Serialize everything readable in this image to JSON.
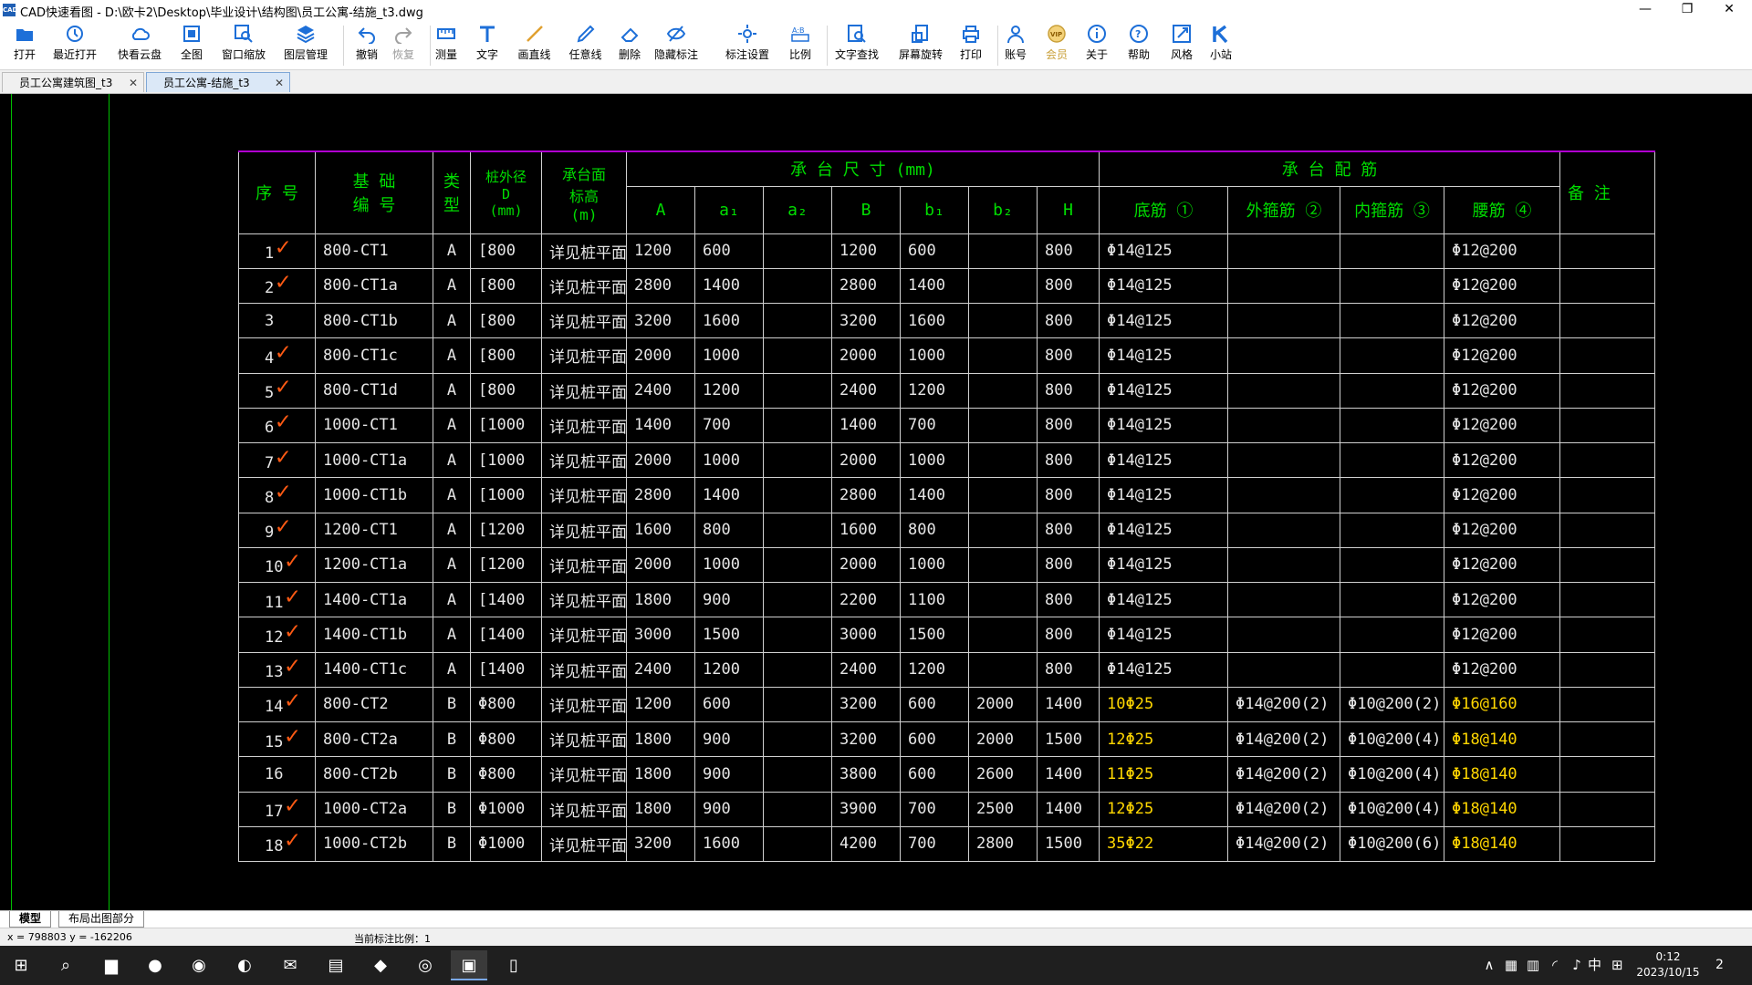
{
  "window": {
    "title": "CAD快速看图 - D:\\欧卡2\\Desktop\\毕业设计\\结构图\\员工公寓-结施_t3.dwg",
    "minimize_glyph": "—",
    "restore_glyph": "❐",
    "close_glyph": "✕"
  },
  "toolbar": [
    {
      "label": "打开",
      "icon": "folder-open-icon"
    },
    {
      "label": "最近打开",
      "icon": "history-icon"
    },
    {
      "label": "快看云盘",
      "icon": "cloud-icon"
    },
    {
      "label": "全图",
      "icon": "fit-all-icon"
    },
    {
      "label": "窗口缩放",
      "icon": "zoom-window-icon"
    },
    {
      "label": "图层管理",
      "icon": "layers-icon"
    },
    {
      "label": "撤销",
      "icon": "undo-icon"
    },
    {
      "label": "恢复",
      "icon": "redo-icon",
      "disabled": true
    },
    {
      "label": "测量",
      "icon": "measure-icon"
    },
    {
      "label": "文字",
      "icon": "text-icon"
    },
    {
      "label": "画直线",
      "icon": "line-icon"
    },
    {
      "label": "任意线",
      "icon": "freehand-icon"
    },
    {
      "label": "删除",
      "icon": "eraser-icon"
    },
    {
      "label": "隐藏标注",
      "icon": "hide-annotation-icon"
    },
    {
      "label": "标注设置",
      "icon": "annotation-settings-icon"
    },
    {
      "label": "比例",
      "icon": "scale-icon"
    },
    {
      "label": "文字查找",
      "icon": "text-search-icon"
    },
    {
      "label": "屏幕旋转",
      "icon": "rotate-screen-icon"
    },
    {
      "label": "打印",
      "icon": "printer-icon"
    },
    {
      "label": "账号",
      "icon": "user-icon"
    },
    {
      "label": "会员",
      "icon": "vip-icon",
      "vip": true
    },
    {
      "label": "关于",
      "icon": "info-icon"
    },
    {
      "label": "帮助",
      "icon": "help-icon"
    },
    {
      "label": "风格",
      "icon": "style-icon"
    },
    {
      "label": "小站",
      "icon": "k-site-icon"
    }
  ],
  "tabs": [
    {
      "label": "员工公寓建筑图_t3",
      "close": "✕",
      "active": false
    },
    {
      "label": "员工公寓-结施_t3",
      "close": "✕",
      "active": true
    }
  ],
  "table": {
    "head": {
      "no": "序 号",
      "name": "基  础\n编  号",
      "type": "类\n型",
      "pile": "桩外径\nD\n(mm)",
      "elev": "承台面\n标高\n(m)",
      "size_group": "承  台  尺  寸      (mm)",
      "rebar_group": "承      台      配      筋",
      "remark": "备  注",
      "size_cols": [
        "A",
        "a₁",
        "a₂",
        "B",
        "b₁",
        "b₂",
        "H"
      ],
      "rebar_cols": [
        "底筋 ①",
        "外箍筋 ②",
        "内箍筋 ③",
        "腰筋 ④"
      ]
    },
    "check_glyph": "✓",
    "rows": [
      {
        "no": "1",
        "check": true,
        "name": "800-CT1",
        "type": "A",
        "pile": "[800",
        "elev": "详见桩平面",
        "A": "1200",
        "a1": "600",
        "a2": "",
        "B": "1200",
        "b1": "600",
        "b2": "",
        "H": "800",
        "r1": "Φ14@125",
        "r2": "",
        "r3": "",
        "r4": "Φ12@200"
      },
      {
        "no": "2",
        "check": true,
        "name": "800-CT1a",
        "type": "A",
        "pile": "[800",
        "elev": "详见桩平面",
        "A": "2800",
        "a1": "1400",
        "a2": "",
        "B": "2800",
        "b1": "1400",
        "b2": "",
        "H": "800",
        "r1": "Φ14@125",
        "r2": "",
        "r3": "",
        "r4": "Φ12@200"
      },
      {
        "no": "3",
        "check": false,
        "name": "800-CT1b",
        "type": "A",
        "pile": "[800",
        "elev": "详见桩平面",
        "A": "3200",
        "a1": "1600",
        "a2": "",
        "B": "3200",
        "b1": "1600",
        "b2": "",
        "H": "800",
        "r1": "Φ14@125",
        "r2": "",
        "r3": "",
        "r4": "Φ12@200"
      },
      {
        "no": "4",
        "check": true,
        "name": "800-CT1c",
        "type": "A",
        "pile": "[800",
        "elev": "详见桩平面",
        "A": "2000",
        "a1": "1000",
        "a2": "",
        "B": "2000",
        "b1": "1000",
        "b2": "",
        "H": "800",
        "r1": "Φ14@125",
        "r2": "",
        "r3": "",
        "r4": "Φ12@200"
      },
      {
        "no": "5",
        "check": true,
        "name": "800-CT1d",
        "type": "A",
        "pile": "[800",
        "elev": "详见桩平面",
        "A": "2400",
        "a1": "1200",
        "a2": "",
        "B": "2400",
        "b1": "1200",
        "b2": "",
        "H": "800",
        "r1": "Φ14@125",
        "r2": "",
        "r3": "",
        "r4": "Φ12@200"
      },
      {
        "no": "6",
        "check": true,
        "name": "1000-CT1",
        "type": "A",
        "pile": "[1000",
        "elev": "详见桩平面",
        "A": "1400",
        "a1": "700",
        "a2": "",
        "B": "1400",
        "b1": "700",
        "b2": "",
        "H": "800",
        "r1": "Φ14@125",
        "r2": "",
        "r3": "",
        "r4": "Φ12@200"
      },
      {
        "no": "7",
        "check": true,
        "name": "1000-CT1a",
        "type": "A",
        "pile": "[1000",
        "elev": "详见桩平面",
        "A": "2000",
        "a1": "1000",
        "a2": "",
        "B": "2000",
        "b1": "1000",
        "b2": "",
        "H": "800",
        "r1": "Φ14@125",
        "r2": "",
        "r3": "",
        "r4": "Φ12@200"
      },
      {
        "no": "8",
        "check": true,
        "name": "1000-CT1b",
        "type": "A",
        "pile": "[1000",
        "elev": "详见桩平面",
        "A": "2800",
        "a1": "1400",
        "a2": "",
        "B": "2800",
        "b1": "1400",
        "b2": "",
        "H": "800",
        "r1": "Φ14@125",
        "r2": "",
        "r3": "",
        "r4": "Φ12@200"
      },
      {
        "no": "9",
        "check": true,
        "name": "1200-CT1",
        "type": "A",
        "pile": "[1200",
        "elev": "详见桩平面",
        "A": "1600",
        "a1": "800",
        "a2": "",
        "B": "1600",
        "b1": "800",
        "b2": "",
        "H": "800",
        "r1": "Φ14@125",
        "r2": "",
        "r3": "",
        "r4": "Φ12@200"
      },
      {
        "no": "10",
        "check": true,
        "name": "1200-CT1a",
        "type": "A",
        "pile": "[1200",
        "elev": "详见桩平面",
        "A": "2000",
        "a1": "1000",
        "a2": "",
        "B": "2000",
        "b1": "1000",
        "b2": "",
        "H": "800",
        "r1": "Φ14@125",
        "r2": "",
        "r3": "",
        "r4": "Φ12@200"
      },
      {
        "no": "11",
        "check": true,
        "name": "1400-CT1a",
        "type": "A",
        "pile": "[1400",
        "elev": "详见桩平面",
        "A": "1800",
        "a1": "900",
        "a2": "",
        "B": "2200",
        "b1": "1100",
        "b2": "",
        "H": "800",
        "r1": "Φ14@125",
        "r2": "",
        "r3": "",
        "r4": "Φ12@200"
      },
      {
        "no": "12",
        "check": true,
        "name": "1400-CT1b",
        "type": "A",
        "pile": "[1400",
        "elev": "详见桩平面",
        "A": "3000",
        "a1": "1500",
        "a2": "",
        "B": "3000",
        "b1": "1500",
        "b2": "",
        "H": "800",
        "r1": "Φ14@125",
        "r2": "",
        "r3": "",
        "r4": "Φ12@200"
      },
      {
        "no": "13",
        "check": true,
        "name": "1400-CT1c",
        "type": "A",
        "pile": "[1400",
        "elev": "详见桩平面",
        "A": "2400",
        "a1": "1200",
        "a2": "",
        "B": "2400",
        "b1": "1200",
        "b2": "",
        "H": "800",
        "r1": "Φ14@125",
        "r2": "",
        "r3": "",
        "r4": "Φ12@200"
      },
      {
        "no": "14",
        "check": true,
        "name": "800-CT2",
        "type": "B",
        "pile": "Φ800",
        "elev": "详见桩平面",
        "A": "1200",
        "a1": "600",
        "a2": "",
        "B": "3200",
        "b1": "600",
        "b2": "2000",
        "H": "1400",
        "r1": "10Φ25",
        "r2": "Φ14@200(2)",
        "r3": "Φ10@200(2)",
        "r4": "Φ16@160"
      },
      {
        "no": "15",
        "check": true,
        "name": "800-CT2a",
        "type": "B",
        "pile": "Φ800",
        "elev": "详见桩平面",
        "A": "1800",
        "a1": "900",
        "a2": "",
        "B": "3200",
        "b1": "600",
        "b2": "2000",
        "H": "1500",
        "r1": "12Φ25",
        "r2": "Φ14@200(2)",
        "r3": "Φ10@200(4)",
        "r4": "Φ18@140"
      },
      {
        "no": "16",
        "check": false,
        "name": "800-CT2b",
        "type": "B",
        "pile": "Φ800",
        "elev": "详见桩平面",
        "A": "1800",
        "a1": "900",
        "a2": "",
        "B": "3800",
        "b1": "600",
        "b2": "2600",
        "H": "1400",
        "r1": "11Φ25",
        "r2": "Φ14@200(2)",
        "r3": "Φ10@200(4)",
        "r4": "Φ18@140"
      },
      {
        "no": "17",
        "check": true,
        "name": "1000-CT2a",
        "type": "B",
        "pile": "Φ1000",
        "elev": "详见桩平面",
        "A": "1800",
        "a1": "900",
        "a2": "",
        "B": "3900",
        "b1": "700",
        "b2": "2500",
        "H": "1400",
        "r1": "12Φ25",
        "r2": "Φ14@200(2)",
        "r3": "Φ10@200(4)",
        "r4": "Φ18@140"
      },
      {
        "no": "18",
        "check": true,
        "name": "1000-CT2b",
        "type": "B",
        "pile": "Φ1000",
        "elev": "详见桩平面",
        "A": "3200",
        "a1": "1600",
        "a2": "",
        "B": "4200",
        "b1": "700",
        "b2": "2800",
        "H": "1500",
        "r1": "35Φ22",
        "r2": "Φ14@200(2)",
        "r3": "Φ10@200(6)",
        "r4": "Φ18@140"
      }
    ]
  },
  "layout_tabs": [
    {
      "label": "模型",
      "active": true
    },
    {
      "label": "布局出图部分",
      "active": false
    }
  ],
  "status": {
    "coords": "x = 798803  y = -162206",
    "scale": "当前标注比例：1"
  },
  "taskbar": {
    "apps": [
      {
        "icon": "windows-start-icon",
        "glyph": "⊞"
      },
      {
        "icon": "search-icon",
        "glyph": "⌕"
      },
      {
        "icon": "file-explorer-icon",
        "glyph": "▆"
      },
      {
        "icon": "chrome-icon",
        "glyph": "●"
      },
      {
        "icon": "steam-icon",
        "glyph": "◉"
      },
      {
        "icon": "edge-icon",
        "glyph": "◐"
      },
      {
        "icon": "wechat-icon",
        "glyph": "✉"
      },
      {
        "icon": "office-icon",
        "glyph": "▤"
      },
      {
        "icon": "app-icon",
        "glyph": "◆"
      },
      {
        "icon": "netease-music-icon",
        "glyph": "◎"
      },
      {
        "icon": "cad-viewer-icon",
        "glyph": "▣",
        "active": true
      },
      {
        "icon": "notepad-icon",
        "glyph": "▯"
      }
    ],
    "tray_glyphs": [
      "∧",
      "▦",
      "▥",
      "◜",
      "♪"
    ],
    "ime": "中",
    "ime_mode_glyph": "⊞",
    "time": "0:12",
    "date": "2023/10/15",
    "notifications": "2"
  },
  "colors": {
    "canvas": "#000000",
    "header_text": "#00dd00",
    "cell_text": "#e6e6e6",
    "rebar_highlight": "#ffd700",
    "check_mark": "#ff5a14",
    "table_top_border": "#b000d0",
    "toolbar_icon": "#1d6fd8"
  }
}
